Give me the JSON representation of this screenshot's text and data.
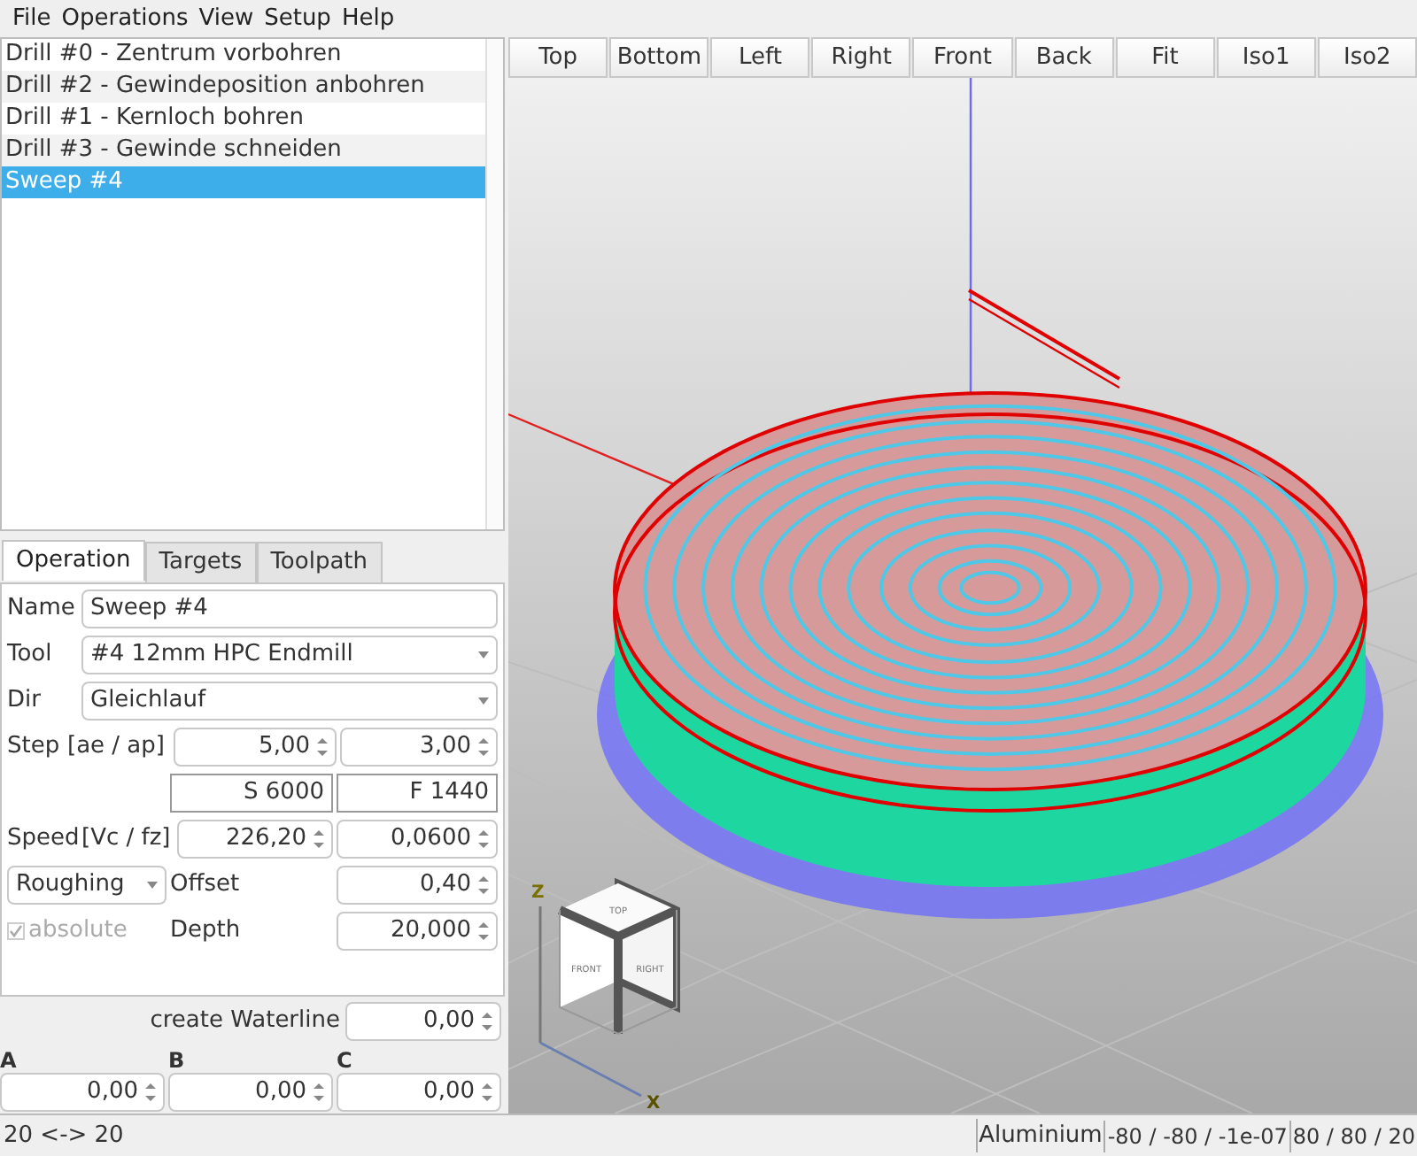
{
  "menu": [
    "File",
    "Operations",
    "View",
    "Setup",
    "Help"
  ],
  "operations": [
    {
      "label": "Drill #0 - Zentrum vorbohren",
      "selected": false
    },
    {
      "label": "Drill #2 - Gewindeposition anbohren",
      "selected": false
    },
    {
      "label": "Drill #1 - Kernloch bohren",
      "selected": false
    },
    {
      "label": "Drill #3 - Gewinde schneiden",
      "selected": false
    },
    {
      "label": "Sweep #4",
      "selected": true
    }
  ],
  "tabs": [
    {
      "label": "Operation",
      "selected": true
    },
    {
      "label": "Targets",
      "selected": false
    },
    {
      "label": "Toolpath",
      "selected": false
    }
  ],
  "form": {
    "name": {
      "label": "Name",
      "value": "Sweep #4"
    },
    "tool": {
      "label": "Tool",
      "value": "#4  12mm HPC Endmill"
    },
    "dir": {
      "label": "Dir",
      "value": "Gleichlauf"
    },
    "step": {
      "label": "Step",
      "unit": "[ae / ap]",
      "ae": "5,00",
      "ap": "3,00"
    },
    "spindle": "S 6000",
    "feed": "F 1440",
    "speed": {
      "label": "Speed",
      "unit": "[Vc /  fz]",
      "vc": "226,20",
      "fz": "0,0600"
    },
    "mode": "Roughing",
    "offset": {
      "label": "Offset",
      "value": "0,40"
    },
    "absolute": {
      "label": "absolute",
      "checked": true,
      "disabled": true
    },
    "depth": {
      "label": "Depth",
      "value": "20,000"
    }
  },
  "waterline": {
    "label": "create Waterline",
    "value": "0,00"
  },
  "axes": [
    {
      "label": "A",
      "value": "0,00"
    },
    {
      "label": "B",
      "value": "0,00"
    },
    {
      "label": "C",
      "value": "0,00"
    }
  ],
  "view_buttons": [
    "Top",
    "Bottom",
    "Left",
    "Right",
    "Front",
    "Back",
    "Fit",
    "Iso1",
    "Iso2"
  ],
  "view_cube": {
    "faces": [
      "TOP",
      "FRONT",
      "RIGHT"
    ],
    "axis_labels": [
      "Z",
      "X"
    ]
  },
  "status_bar": {
    "message": "20 <-> 20",
    "material": "Aluminium",
    "min": "-80 / -80 / -1e-07",
    "max": "80 / 80 / 20"
  }
}
